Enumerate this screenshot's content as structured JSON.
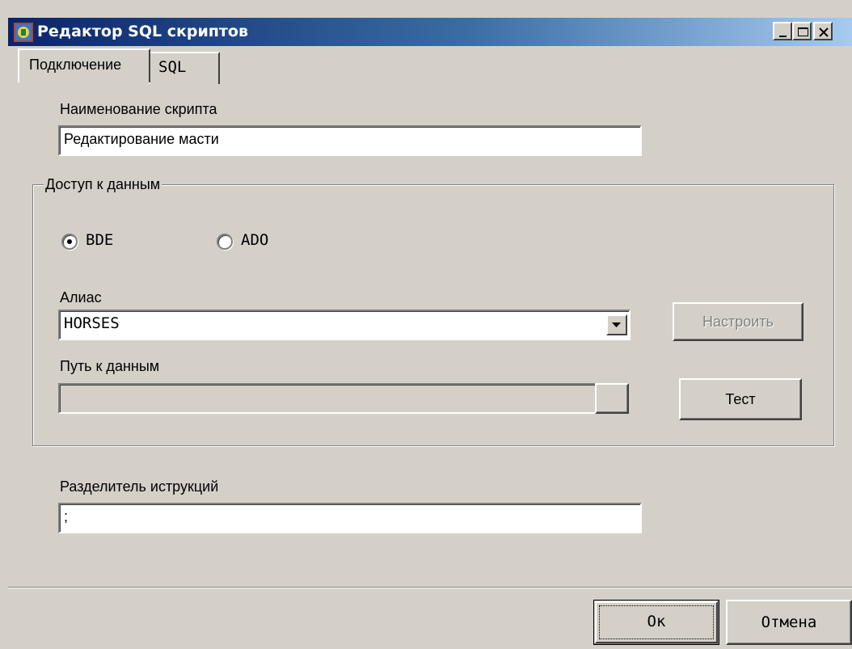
{
  "window": {
    "title": "Редактор SQL скриптов",
    "icon": "app-icon"
  },
  "tabs": [
    {
      "label": "Подключение",
      "active": true
    },
    {
      "label": "SQL",
      "active": false
    }
  ],
  "script_name": {
    "label": "Наименование скрипта",
    "value": "Редактирование масти"
  },
  "data_access": {
    "legend": "Доступ к данным",
    "options": [
      {
        "label": "BDE",
        "selected": true
      },
      {
        "label": "ADO",
        "selected": false
      }
    ],
    "alias": {
      "label": "Алиас",
      "value": "HORSES"
    },
    "configure_button": "Настроить",
    "path": {
      "label": "Путь к данным",
      "value": ""
    },
    "test_button": "Тест"
  },
  "separator": {
    "label": "Разделитель иструкций",
    "value": ";"
  },
  "footer": {
    "ok_label": "Ок",
    "cancel_label": "Отмена"
  }
}
